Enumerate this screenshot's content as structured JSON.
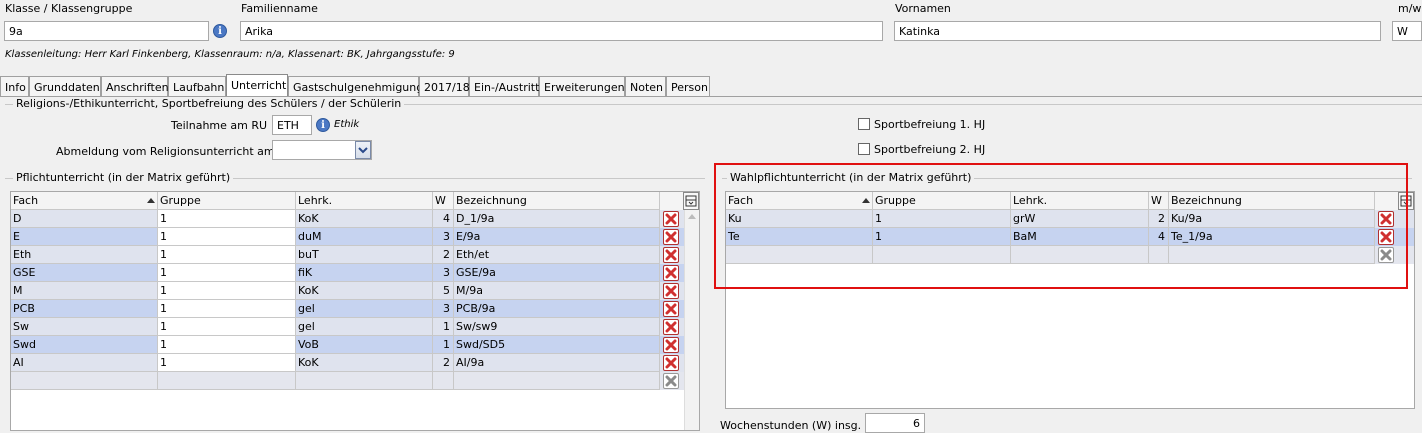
{
  "header": {
    "klasse_label": "Klasse / Klassengruppe",
    "klasse_value": "9a",
    "familienname_label": "Familienname",
    "familienname_value": "Arika",
    "vornamen_label": "Vornamen",
    "vornamen_value": "Katinka",
    "mw_label": "m/w",
    "mw_value": "W",
    "klassenleitung": "Klassenleitung: Herr Karl Finkenberg, Klassenraum: n/a, Klassenart: BK, Jahrgangsstufe: 9"
  },
  "tabs": [
    "Info",
    "Grunddaten",
    "Anschriften",
    "Laufbahn",
    "Unterricht",
    "Gastschulgenehmigung",
    "2017/18",
    "Ein-/Austritt",
    "Erweiterungen",
    "Noten",
    "Person"
  ],
  "active_tab": "Unterricht",
  "religion": {
    "group_title": "Religions-/Ethikunterricht, Sportbefreiung des Schülers / der Schülerin",
    "teilnahme_label": "Teilnahme am RU",
    "teilnahme_value": "ETH",
    "teilnahme_desc": "Ethik",
    "abmeldung_label": "Abmeldung vom Religionsunterricht am",
    "abmeldung_value": "",
    "sport1_label": "Sportbefreiung 1. HJ",
    "sport2_label": "Sportbefreiung 2. HJ"
  },
  "pflicht": {
    "group_title": "Pflichtunterricht (in der Matrix geführt)",
    "columns": [
      "Fach",
      "Gruppe",
      "Lehrk.",
      "W",
      "Bezeichnung"
    ],
    "rows": [
      {
        "fach": "D",
        "gruppe": "1",
        "lehrk": "KoK",
        "w": "4",
        "bez": "D_1/9a"
      },
      {
        "fach": "E",
        "gruppe": "1",
        "lehrk": "duM",
        "w": "3",
        "bez": "E/9a"
      },
      {
        "fach": "Eth",
        "gruppe": "1",
        "lehrk": "buT",
        "w": "2",
        "bez": "Eth/et"
      },
      {
        "fach": "GSE",
        "gruppe": "1",
        "lehrk": "fiK",
        "w": "3",
        "bez": "GSE/9a"
      },
      {
        "fach": "M",
        "gruppe": "1",
        "lehrk": "KoK",
        "w": "5",
        "bez": "M/9a"
      },
      {
        "fach": "PCB",
        "gruppe": "1",
        "lehrk": "gel",
        "w": "3",
        "bez": "PCB/9a"
      },
      {
        "fach": "Sw",
        "gruppe": "1",
        "lehrk": "gel",
        "w": "1",
        "bez": "Sw/sw9"
      },
      {
        "fach": "Swd",
        "gruppe": "1",
        "lehrk": "VoB",
        "w": "1",
        "bez": "Swd/SD5"
      },
      {
        "fach": "AI",
        "gruppe": "1",
        "lehrk": "KoK",
        "w": "2",
        "bez": "AI/9a"
      }
    ]
  },
  "wahlpflicht": {
    "group_title": "Wahlpflichtunterricht (in der Matrix geführt)",
    "columns": [
      "Fach",
      "Gruppe",
      "Lehrk.",
      "W",
      "Bezeichnung"
    ],
    "rows": [
      {
        "fach": "Ku",
        "gruppe": "1",
        "lehrk": "grW",
        "w": "2",
        "bez": "Ku/9a"
      },
      {
        "fach": "Te",
        "gruppe": "1",
        "lehrk": "BaM",
        "w": "4",
        "bez": "Te_1/9a"
      }
    ],
    "wochenstunden_label": "Wochenstunden (W) insg.",
    "wochenstunden_value": "6"
  },
  "colors": {
    "highlight": "#e01010",
    "row_alt": "#c6d3f0",
    "row": "#dfe3ee",
    "delete_icon": "#d03030"
  }
}
